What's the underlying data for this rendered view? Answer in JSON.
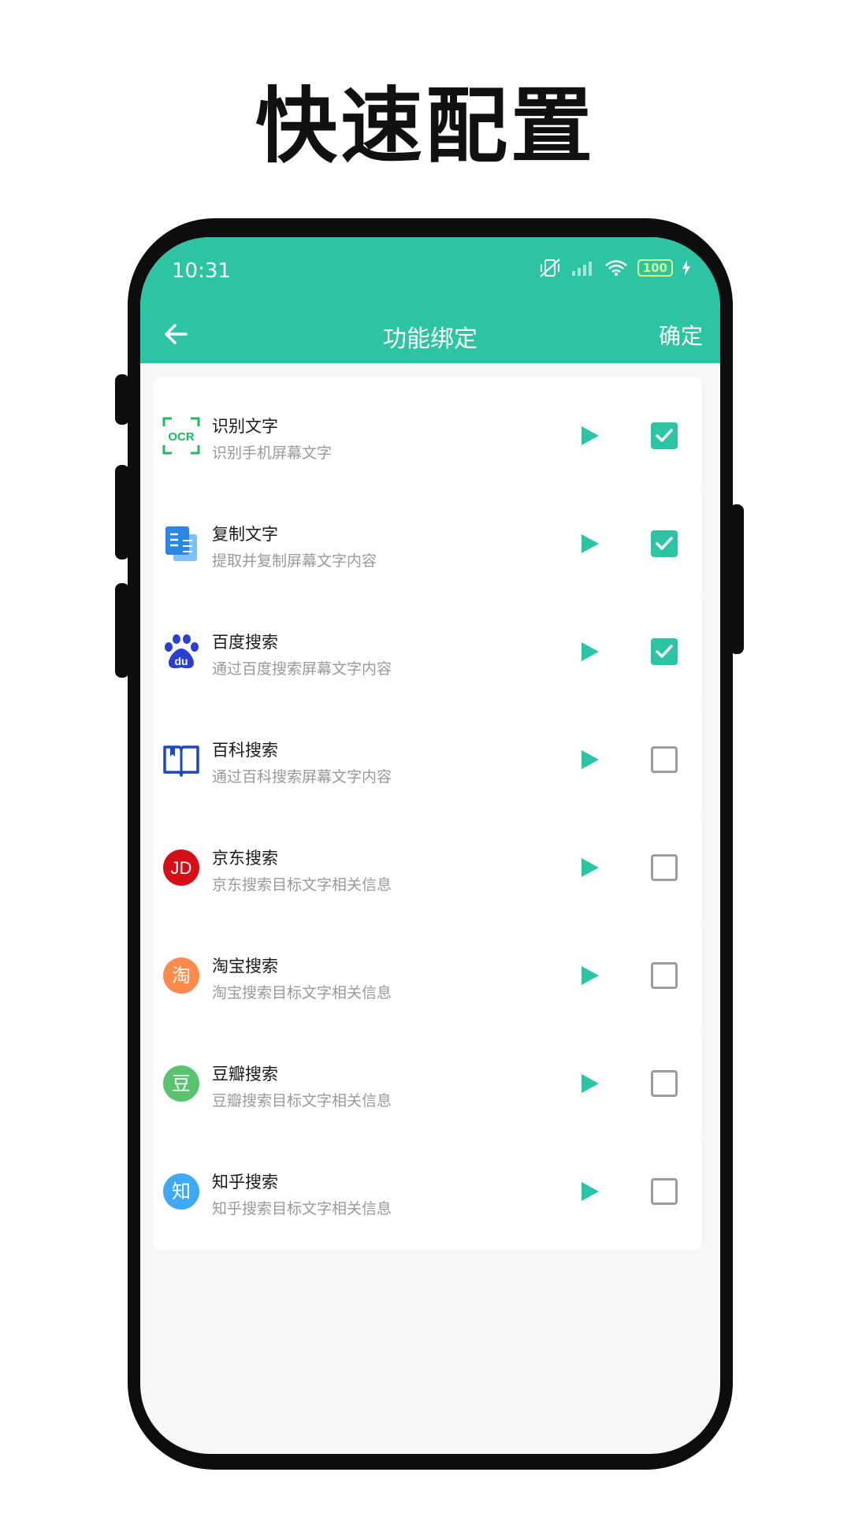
{
  "promo": {
    "title": "快速配置"
  },
  "status_bar": {
    "time": "10:31",
    "battery": "100"
  },
  "app_bar": {
    "title": "功能绑定",
    "confirm_label": "确定",
    "back_icon": "arrow-left-icon"
  },
  "colors": {
    "accent": "#2dc4a3",
    "checkbox_border": "#9c9c9c"
  },
  "items": [
    {
      "title": "识别文字",
      "desc": "识别手机屏幕文字",
      "icon": "ocr-icon",
      "checked": true,
      "icon_text": "OCR"
    },
    {
      "title": "复制文字",
      "desc": "提取并复制屏幕文字内容",
      "icon": "copy-document-icon",
      "checked": true
    },
    {
      "title": "百度搜索",
      "desc": "通过百度搜索屏幕文字内容",
      "icon": "baidu-paw-icon",
      "checked": true,
      "icon_text": "du"
    },
    {
      "title": "百科搜索",
      "desc": "通过百科搜索屏幕文字内容",
      "icon": "book-icon",
      "checked": false
    },
    {
      "title": "京东搜索",
      "desc": "京东搜索目标文字相关信息",
      "icon": "jd-icon",
      "checked": false,
      "icon_text": "JD"
    },
    {
      "title": "淘宝搜索",
      "desc": "淘宝搜索目标文字相关信息",
      "icon": "taobao-icon",
      "checked": false,
      "icon_text": "淘"
    },
    {
      "title": "豆瓣搜索",
      "desc": "豆瓣搜索目标文字相关信息",
      "icon": "douban-icon",
      "checked": false,
      "icon_text": "豆"
    },
    {
      "title": "知乎搜索",
      "desc": "知乎搜索目标文字相关信息",
      "icon": "zhihu-icon",
      "checked": false,
      "icon_text": "知"
    }
  ]
}
